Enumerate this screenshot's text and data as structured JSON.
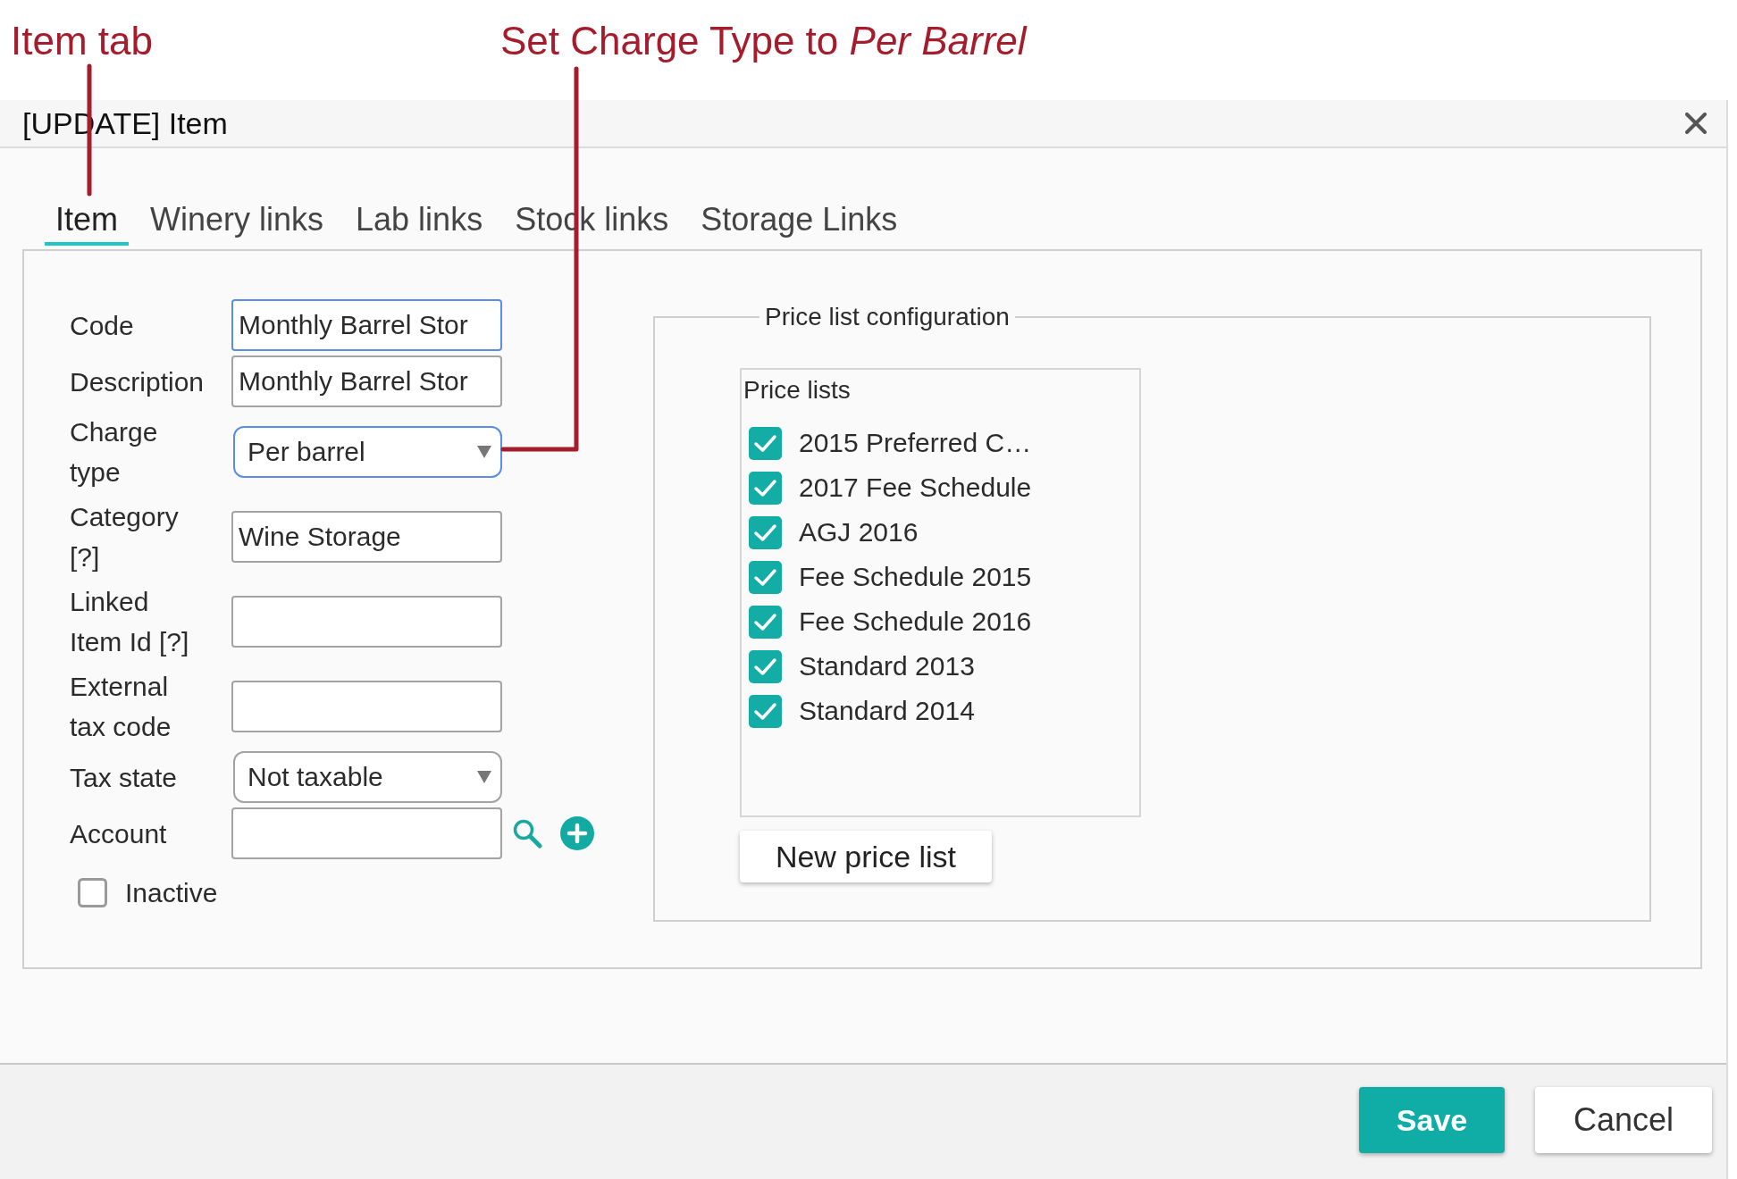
{
  "annotations": [
    {
      "text": "Item tab"
    },
    {
      "text": "Set Charge Type to *Per Barrel*"
    }
  ],
  "dialog": {
    "title": "[UPDATE] Item"
  },
  "tabs": [
    {
      "label": "Item",
      "selected": true
    },
    {
      "label": "Winery links",
      "selected": false
    },
    {
      "label": "Lab links",
      "selected": false
    },
    {
      "label": "Stock links",
      "selected": false
    },
    {
      "label": "Storage Links",
      "selected": false
    }
  ],
  "form": {
    "fields": [
      {
        "kind": "text",
        "label": "Code",
        "value": "Monthly Barrel Stor",
        "focused": true
      },
      {
        "kind": "text",
        "label": "Description",
        "value": "Monthly Barrel Stor",
        "focused": false
      },
      {
        "kind": "select",
        "label": "Charge type",
        "value": "Per barrel",
        "focused": true
      },
      {
        "kind": "text",
        "label": "Category [?]",
        "value": "Wine Storage",
        "focused": false
      },
      {
        "kind": "text",
        "label": "Linked Item Id [?]",
        "focused": false
      },
      {
        "kind": "text",
        "label": "External tax code",
        "focused": false
      },
      {
        "kind": "select",
        "label": "Tax state",
        "value": "Not taxable",
        "focused": false
      },
      {
        "kind": "lookup",
        "label": "Account",
        "focused": false
      }
    ],
    "inactive": {
      "label": "Inactive",
      "checked": false
    }
  },
  "price_list_config": {
    "legend": "Price list configuration",
    "list_title": "Price lists",
    "items": [
      {
        "label": "2015 Preferred C…",
        "checked": true
      },
      {
        "label": "2017 Fee Schedule",
        "checked": true
      },
      {
        "label": "AGJ 2016",
        "checked": true
      },
      {
        "label": "Fee Schedule 2015",
        "checked": true
      },
      {
        "label": "Fee Schedule 2016",
        "checked": true
      },
      {
        "label": "Standard 2013",
        "checked": true
      },
      {
        "label": "Standard 2014",
        "checked": true
      }
    ],
    "new_button": "New price list"
  },
  "footer": {
    "buttons": [
      {
        "label": "Save",
        "kind": "primary"
      },
      {
        "label": "Cancel",
        "kind": "secondary"
      }
    ]
  }
}
